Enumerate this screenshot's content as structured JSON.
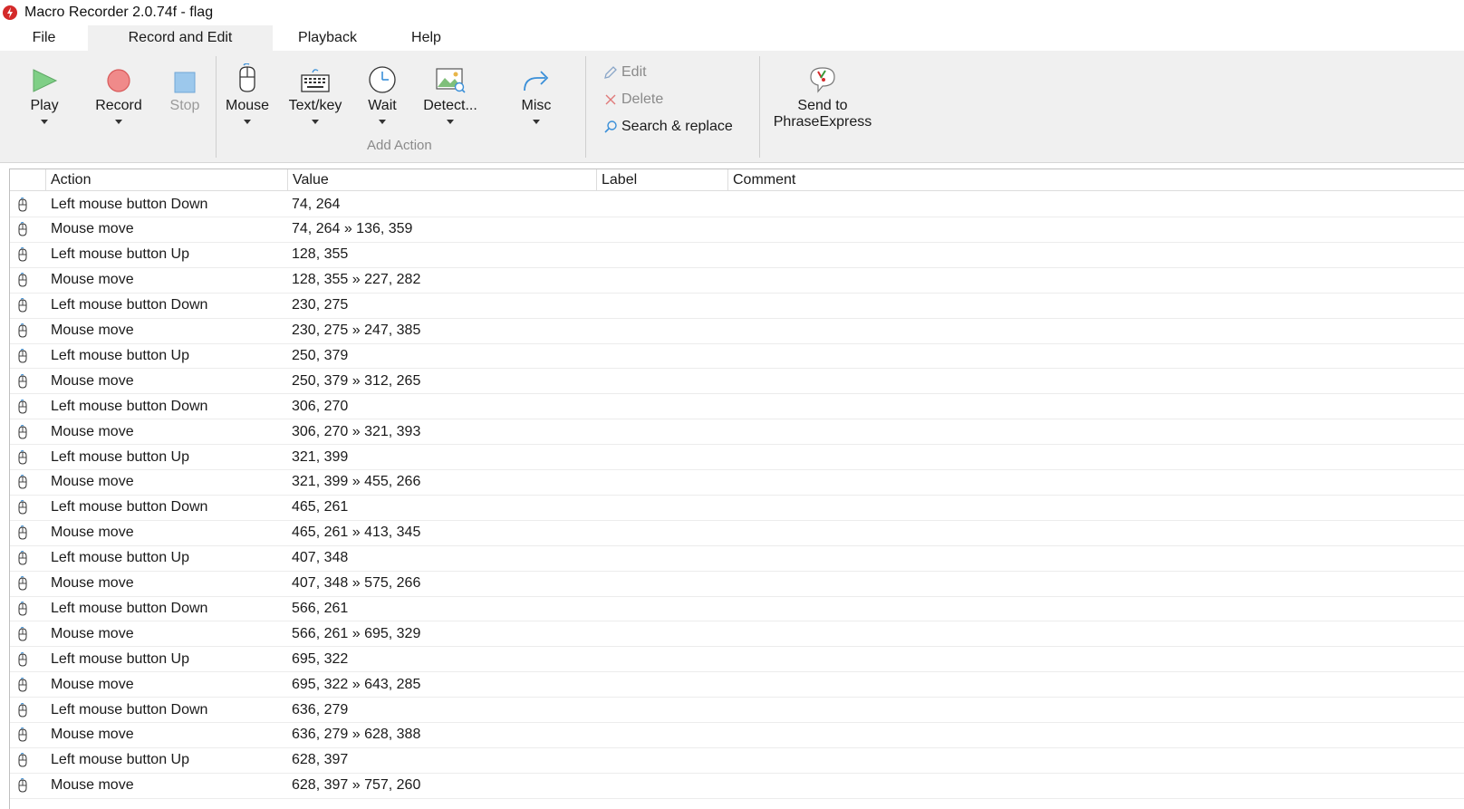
{
  "window": {
    "title": "Macro Recorder 2.0.74f - flag",
    "icon": "macro-recorder-logo-icon"
  },
  "menu": {
    "tabs": [
      {
        "label": "File",
        "active": false
      },
      {
        "label": "Record and Edit",
        "active": true
      },
      {
        "label": "Playback",
        "active": false
      },
      {
        "label": "Help",
        "active": false
      }
    ]
  },
  "ribbon": {
    "play": {
      "label": "Play",
      "icon": "play-icon"
    },
    "record": {
      "label": "Record",
      "icon": "record-icon"
    },
    "stop": {
      "label": "Stop",
      "icon": "stop-icon",
      "disabled": true
    },
    "mouse": {
      "label": "Mouse",
      "icon": "mouse-icon"
    },
    "textkey": {
      "label": "Text/key",
      "icon": "keyboard-icon"
    },
    "wait": {
      "label": "Wait",
      "icon": "clock-icon"
    },
    "detect": {
      "label": "Detect...",
      "icon": "image-detect-icon"
    },
    "misc": {
      "label": "Misc",
      "icon": "redo-arrow-icon"
    },
    "add_action_group": "Add Action",
    "edit": {
      "label": "Edit",
      "icon": "pencil-icon",
      "disabled": true
    },
    "delete": {
      "label": "Delete",
      "icon": "x-icon",
      "disabled": true
    },
    "search_replace": {
      "label": "Search & replace",
      "icon": "magnifier-icon"
    },
    "send_phraseexpress": {
      "label_line1": "Send to",
      "label_line2": "PhraseExpress",
      "icon": "phraseexpress-icon"
    }
  },
  "table": {
    "columns": [
      "Action",
      "Value",
      "Label",
      "Comment"
    ],
    "rows": [
      {
        "action": "Left mouse button Down",
        "value": "74, 264"
      },
      {
        "action": "Mouse move",
        "value": "74, 264 » 136, 359"
      },
      {
        "action": "Left mouse button Up",
        "value": "128, 355"
      },
      {
        "action": "Mouse move",
        "value": "128, 355 » 227, 282"
      },
      {
        "action": "Left mouse button Down",
        "value": "230, 275"
      },
      {
        "action": "Mouse move",
        "value": "230, 275 » 247, 385"
      },
      {
        "action": "Left mouse button Up",
        "value": "250, 379"
      },
      {
        "action": "Mouse move",
        "value": "250, 379 » 312, 265"
      },
      {
        "action": "Left mouse button Down",
        "value": "306, 270"
      },
      {
        "action": "Mouse move",
        "value": "306, 270 » 321, 393"
      },
      {
        "action": "Left mouse button Up",
        "value": "321, 399"
      },
      {
        "action": "Mouse move",
        "value": "321, 399 » 455, 266"
      },
      {
        "action": "Left mouse button Down",
        "value": "465, 261"
      },
      {
        "action": "Mouse move",
        "value": "465, 261 » 413, 345"
      },
      {
        "action": "Left mouse button Up",
        "value": "407, 348"
      },
      {
        "action": "Mouse move",
        "value": "407, 348 » 575, 266"
      },
      {
        "action": "Left mouse button Down",
        "value": "566, 261"
      },
      {
        "action": "Mouse move",
        "value": "566, 261 » 695, 329"
      },
      {
        "action": "Left mouse button Up",
        "value": "695, 322"
      },
      {
        "action": "Mouse move",
        "value": "695, 322 » 643, 285"
      },
      {
        "action": "Left mouse button Down",
        "value": "636, 279"
      },
      {
        "action": "Mouse move",
        "value": "636, 279 » 628, 388"
      },
      {
        "action": "Left mouse button Up",
        "value": "628, 397"
      },
      {
        "action": "Mouse move",
        "value": "628, 397 » 757, 260"
      }
    ]
  }
}
